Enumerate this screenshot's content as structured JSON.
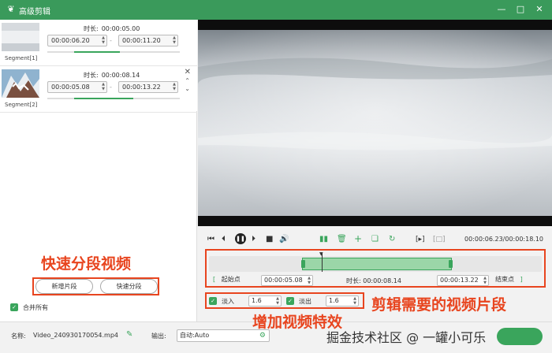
{
  "app": {
    "title": "高级剪辑"
  },
  "segments": [
    {
      "label": "Segment[1]",
      "duration_label": "时长:",
      "duration": "00:00:05.00",
      "start": "00:00:06.20",
      "end": "00:00:11.20",
      "progress": 0.35
    },
    {
      "label": "Segment[2]",
      "duration_label": "时长:",
      "duration": "00:00:08.14",
      "start": "00:00:05.08",
      "end": "00:00:13.22",
      "progress": 0.45
    }
  ],
  "left_actions": {
    "add_segment": "新增片段",
    "quick_split": "快速分段",
    "merge_all": "合并所有"
  },
  "annotations": {
    "quick_split_video": "快速分段视频",
    "clip_needed": "剪辑需要的视频片段",
    "add_effects": "增加视频特效"
  },
  "player": {
    "time_current": "00:00:06.23",
    "time_total": "00:00:18.10"
  },
  "trim": {
    "start_button": "起始点",
    "start_time": "00:00:05.08",
    "duration_label": "时长:",
    "duration": "00:00:08.14",
    "end_time": "00:00:13.22",
    "end_button": "结束点",
    "range_start_fraction": 0.28,
    "range_end_fraction": 0.73,
    "playhead_fraction": 0.34
  },
  "effects": {
    "fade_in_label": "淡入",
    "fade_in_value": "1.6",
    "fade_out_label": "淡出",
    "fade_out_value": "1.6"
  },
  "bottom": {
    "name_label": "名称:",
    "file_name": "Video_240930170054.mp4",
    "output_label": "输出:",
    "output_value": "自动:Auto"
  },
  "watermark": "掘金技术社区 @ 一罐小可乐",
  "colors": {
    "accent": "#3aa55c",
    "annotation": "#e8451f"
  }
}
